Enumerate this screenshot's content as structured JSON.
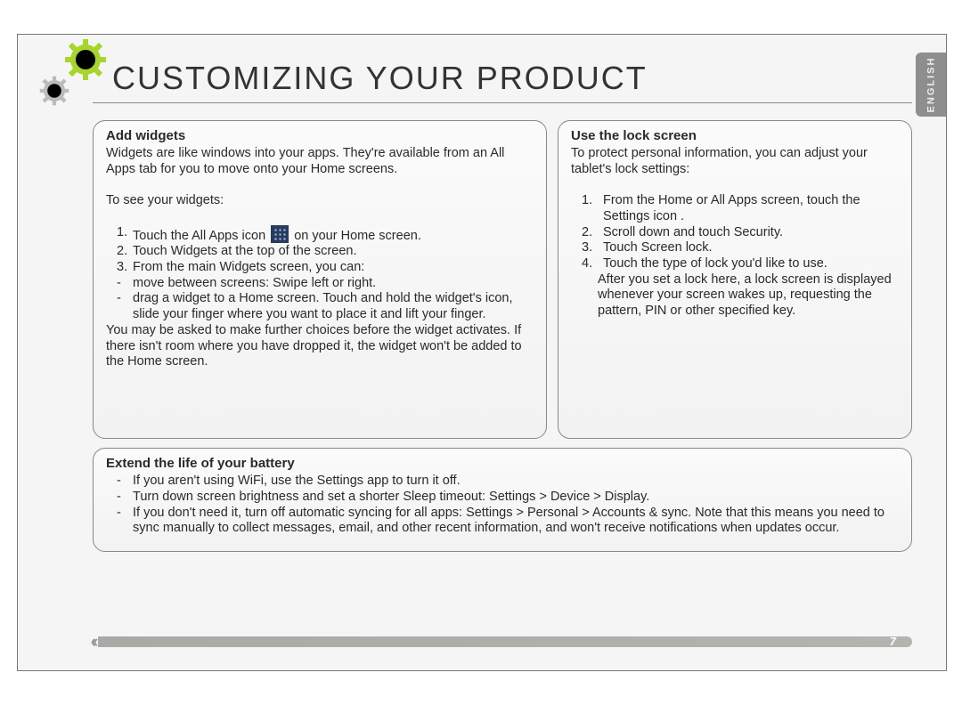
{
  "lang_label": "ENGLISH",
  "title": "CUSTOMIZING YOUR PRODUCT",
  "page_number": "7",
  "widgets": {
    "heading": "Add widgets",
    "intro": "Widgets are like windows into your apps. They're available from an All Apps tab for you to move onto your Home screens.",
    "see_line": "To see your widgets:",
    "step1_a": "Touch the All Apps icon",
    "step1_b": "on your Home screen.",
    "step2": "Touch Widgets at the top of the screen.",
    "step3": "From the main Widgets screen, you can:",
    "bullet1": "move between screens: Swipe left or right.",
    "bullet2": "drag a widget to a Home screen. Touch and hold the widget's icon, slide your finger where you want to place it and lift your finger.",
    "outro": "You may be asked to make further choices before the widget activates. If there isn't room where you have dropped it, the widget won't be added to the Home screen."
  },
  "lock": {
    "heading": "Use the lock screen",
    "intro": "To protect personal information, you can adjust your tablet's lock settings:",
    "step1": "From the Home or All Apps screen, touch the Settings icon .",
    "step2": "Scroll down and touch Security.",
    "step3": "Touch Screen lock.",
    "step4": "Touch the type of lock you'd like to use.",
    "outro": "After you set a lock here, a lock screen is displayed whenever your screen wakes up, requesting the pattern, PIN or other specified key."
  },
  "battery": {
    "heading": "Extend the life of your battery",
    "b1": "If you aren't using WiFi, use the Settings app to turn it off.",
    "b2": "Turn down screen brightness and set a shorter Sleep timeout: Settings > Device > Display.",
    "b3": "If you don't need it, turn off automatic syncing for all apps: Settings > Personal > Accounts & sync. Note that this means you need to sync manually to collect messages, email, and other recent information, and won't receive notifications when updates occur."
  }
}
